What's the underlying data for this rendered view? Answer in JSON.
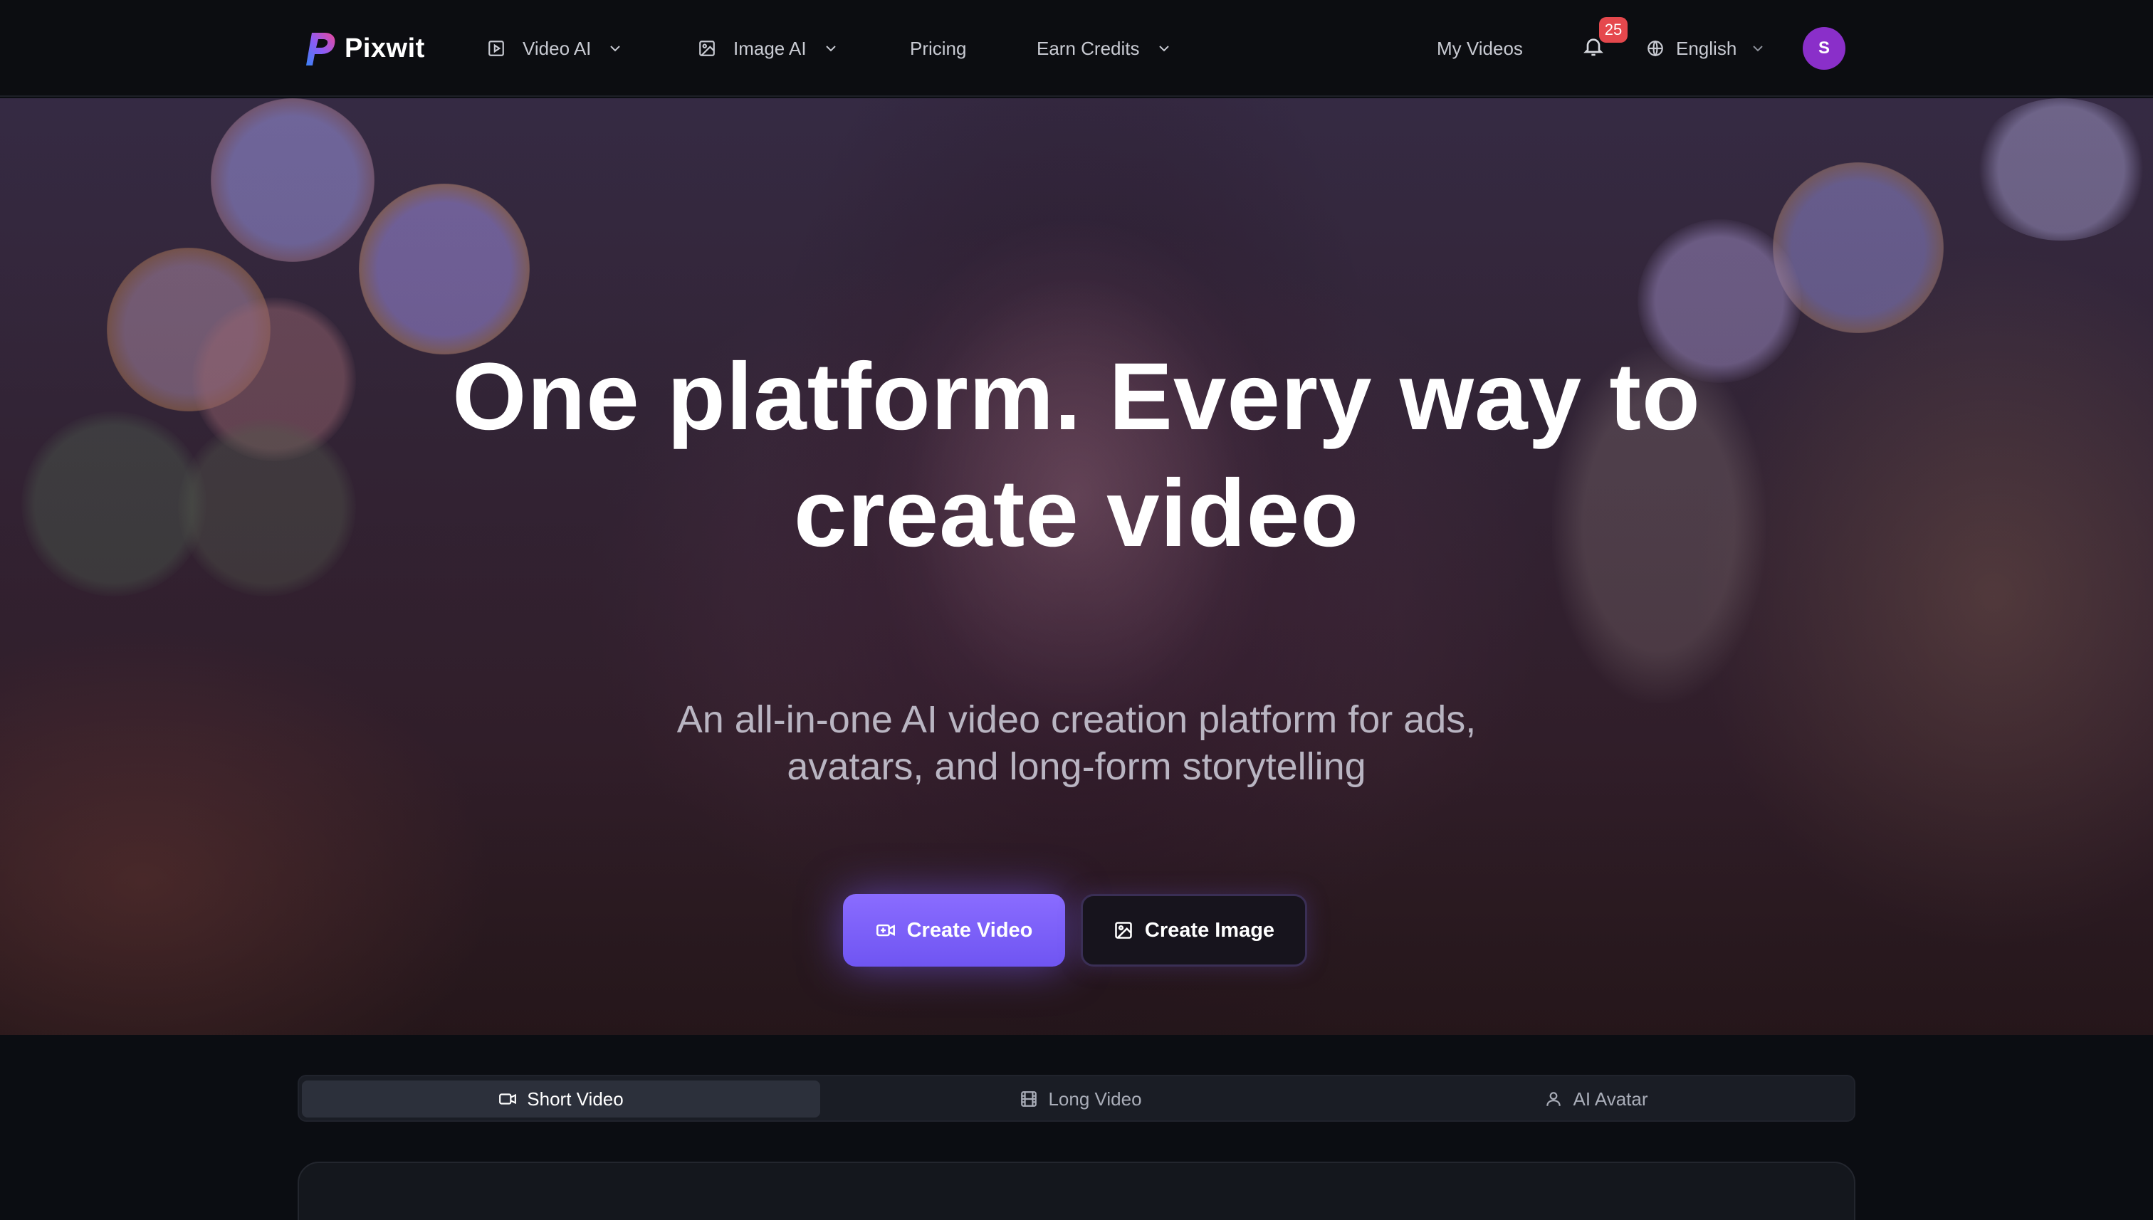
{
  "brand": {
    "name": "Pixwit"
  },
  "nav": {
    "items": [
      {
        "label": "Video AI",
        "icon": "play-square-icon",
        "dropdown": true
      },
      {
        "label": "Image AI",
        "icon": "image-icon",
        "dropdown": true
      },
      {
        "label": "Pricing"
      },
      {
        "label": "Earn Credits",
        "dropdown": true
      }
    ],
    "my_videos": "My Videos",
    "notifications_count": "25",
    "language": "English",
    "avatar_initial": "S"
  },
  "hero": {
    "title_line1": "One platform. Every way to",
    "title_line2": "create video",
    "subtitle_line1": "An all-in-one AI video creation platform for ads,",
    "subtitle_line2": "avatars, and long-form storytelling",
    "primary_button": "Create Video",
    "secondary_button": "Create Image"
  },
  "tabs": [
    {
      "label": "Short Video",
      "icon": "video-camera-icon",
      "active": true
    },
    {
      "label": "Long Video",
      "icon": "film-icon",
      "active": false
    },
    {
      "label": "AI Avatar",
      "icon": "user-icon",
      "active": false
    }
  ],
  "colors": {
    "accent": "#7c62ff",
    "badge": "#e5484d",
    "avatar": "#8a2fc9",
    "nav_bg": "#0c0d11"
  }
}
